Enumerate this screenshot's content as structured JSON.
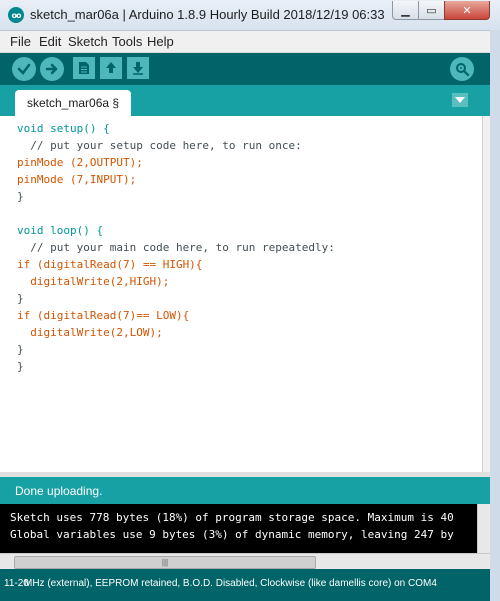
{
  "window": {
    "title": "sketch_mar06a | Arduino 1.8.9 Hourly Build 2018/12/19 06:33",
    "app_icon_text": "oo",
    "minimize_glyph": "▁",
    "maximize_glyph": "▭",
    "close_glyph": "✕"
  },
  "menu": [
    "File",
    "Edit",
    "Sketch",
    "Tools",
    "Help"
  ],
  "toolbar": {
    "buttons": [
      "verify-icon",
      "upload-icon",
      "new-icon",
      "open-icon",
      "save-icon",
      "serial-monitor-icon"
    ]
  },
  "tabs": [
    {
      "label": "sketch_mar06a §"
    }
  ],
  "editor": {
    "lines": [
      "void setup() {",
      "  // put your setup code here, to run once:",
      "pinMode (2,OUTPUT);",
      "pinMode (7,INPUT);",
      "}",
      "",
      "void loop() {",
      "  // put your main code here, to run repeatedly:",
      "if (digitalRead(7) == HIGH){",
      "  digitalWrite(2,HIGH);",
      "}",
      "if (digitalRead(7)== LOW){",
      "  digitalWrite(2,LOW);",
      "}",
      "}"
    ]
  },
  "status": {
    "message": "Done uploading."
  },
  "console": {
    "lines": [
      "Sketch uses 778 bytes (18%) of program storage space. Maximum is 40",
      "Global variables use 9 bytes (3%) of dynamic memory, leaving 247 by"
    ],
    "scroll_thumb": "|||"
  },
  "bottom": {
    "line_number": "11-20",
    "board_info": "MHz (external), EEPROM retained, B.O.D. Disabled, Clockwise (like damellis core) on COM4"
  },
  "colors": {
    "toolbar": "#006468",
    "tabstrip": "#17a1a5",
    "button": "#4db7bb",
    "keyword": "#00979c",
    "function": "#d35400"
  }
}
